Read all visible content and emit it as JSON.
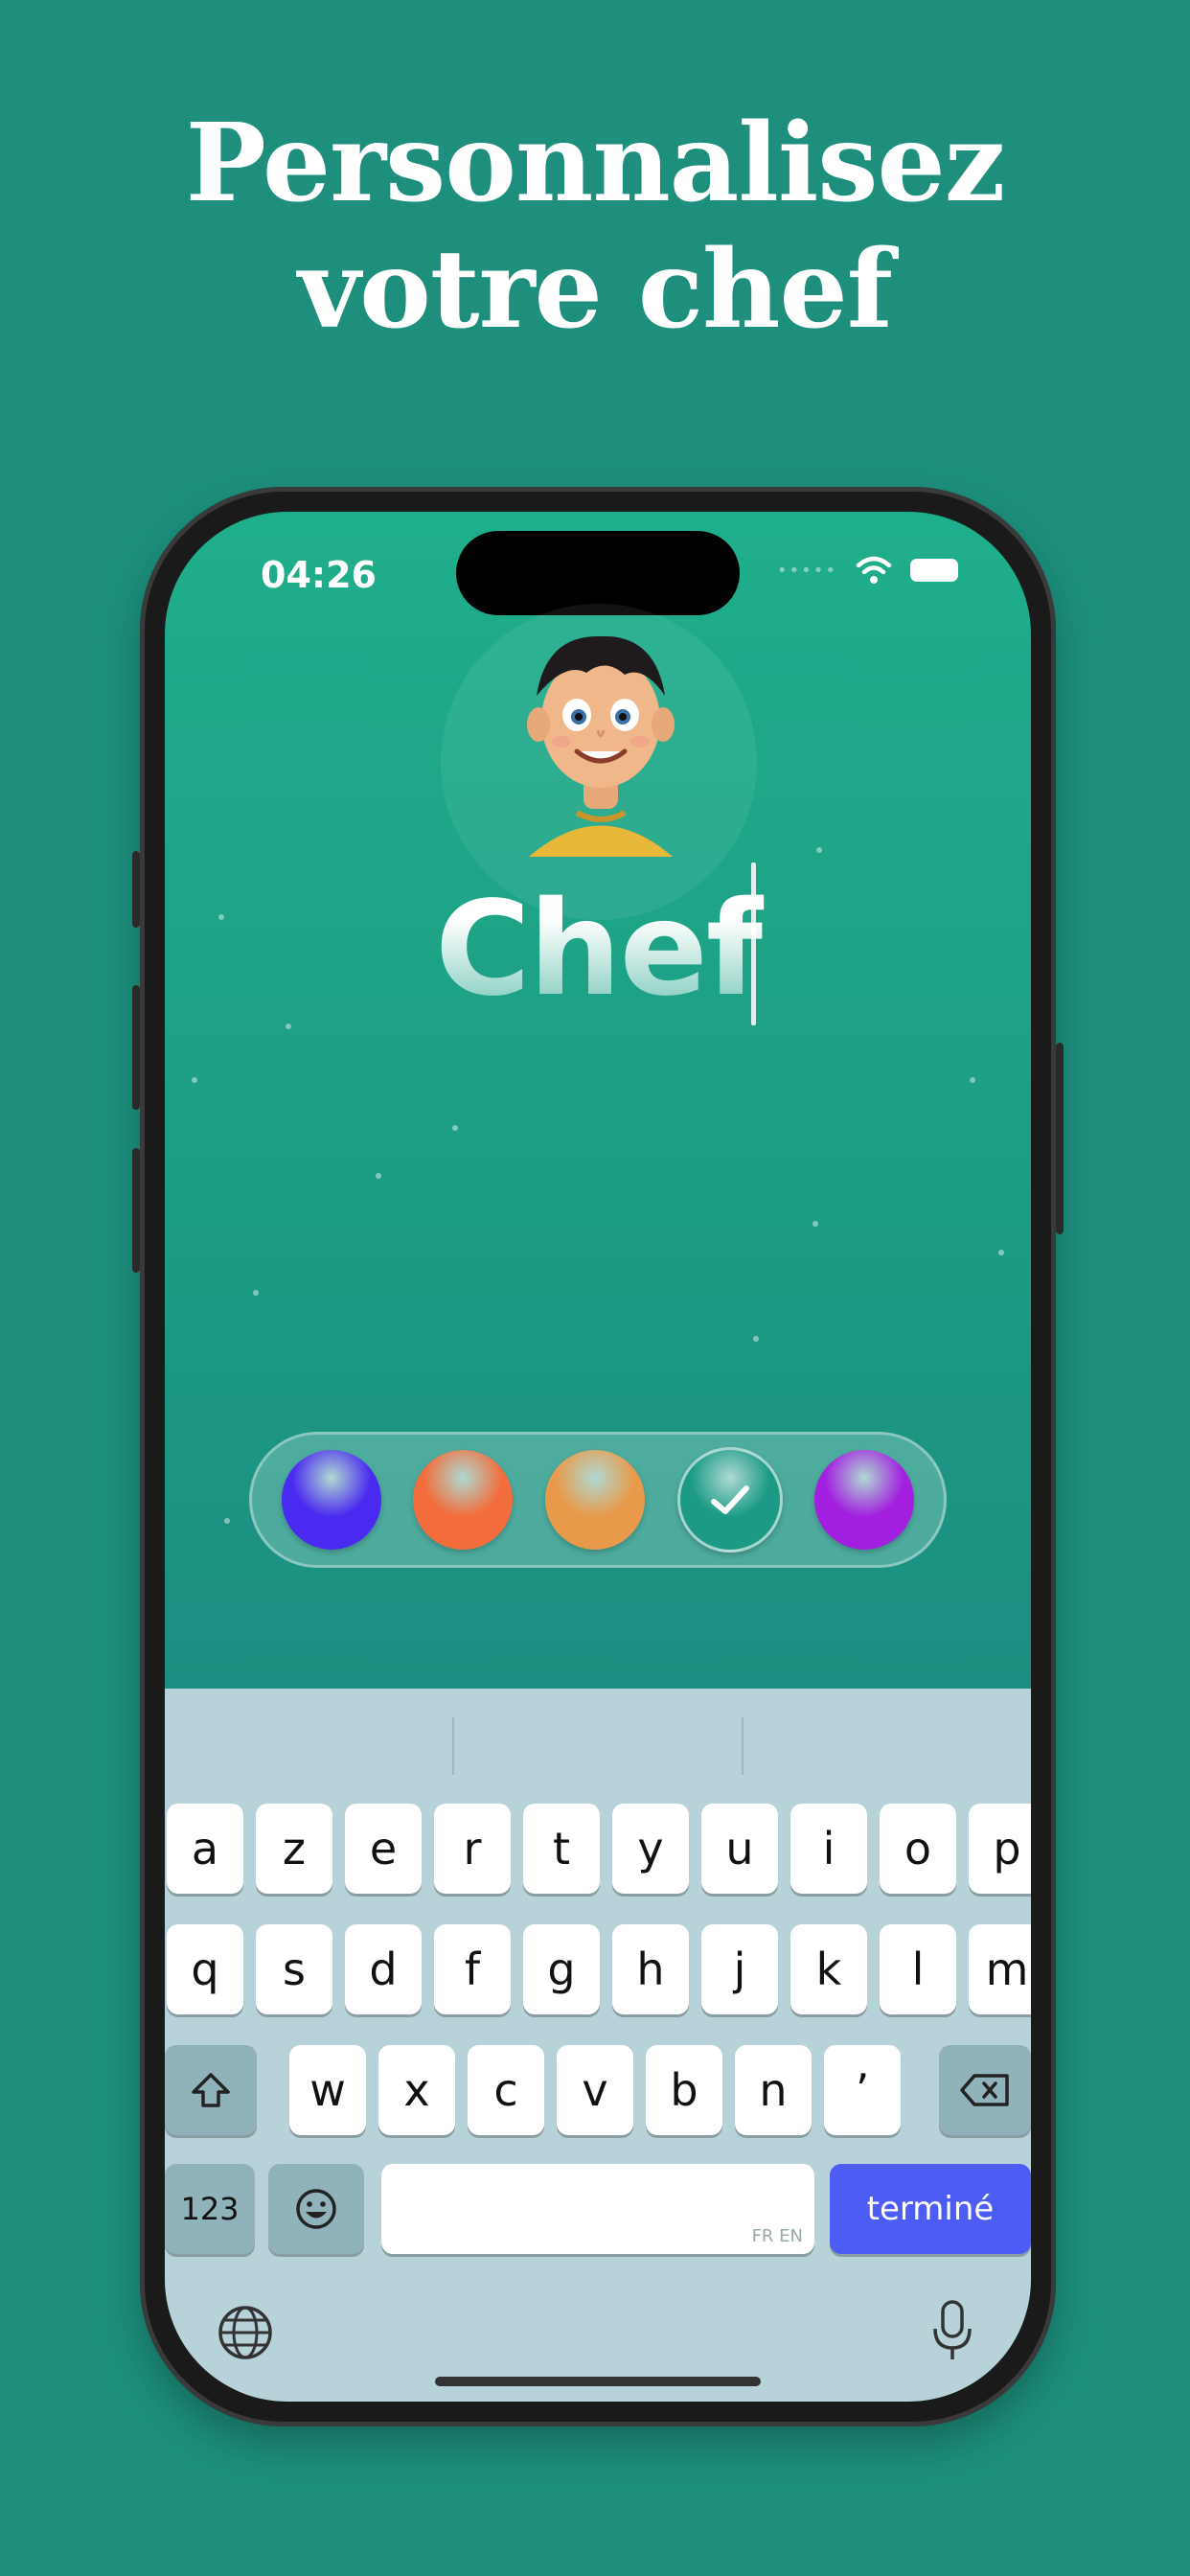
{
  "headline": {
    "line1": "Personnalisez",
    "line2": "votre chef"
  },
  "status_bar": {
    "time": "04:26"
  },
  "profile": {
    "name": "Chef"
  },
  "colors": {
    "options": [
      "#4a2af0",
      "#f26d3b",
      "#e89a4a",
      "#1c9a86",
      "#a21fe0"
    ],
    "selected_index": 3
  },
  "keyboard": {
    "row1": [
      "a",
      "z",
      "e",
      "r",
      "t",
      "y",
      "u",
      "i",
      "o",
      "p"
    ],
    "row2": [
      "q",
      "s",
      "d",
      "f",
      "g",
      "h",
      "j",
      "k",
      "l",
      "m"
    ],
    "row3": [
      "w",
      "x",
      "c",
      "v",
      "b",
      "n",
      "’"
    ],
    "numbers_label": "123",
    "done_label": "terminé",
    "space_hint": "FR EN"
  }
}
